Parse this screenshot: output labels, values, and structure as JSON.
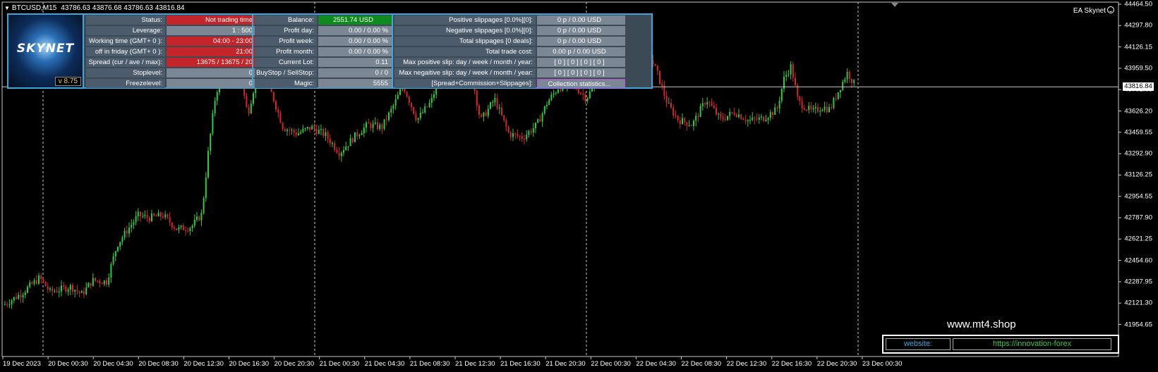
{
  "chart": {
    "symbol_tf": "BTCUSD,M15",
    "ohlc": "43786.63 43876.68 43786.63 43816.84",
    "ea_name": "EA Skynet",
    "current_price": "43816.84",
    "price_labels": [
      "44464.50",
      "44297.80",
      "44126.15",
      "43959.50",
      "43792.85",
      "43626.20",
      "43459.55",
      "43292.90",
      "43126.25",
      "42954.55",
      "42787.90",
      "42621.25",
      "42454.60",
      "42287.95",
      "42121.30",
      "41954.65"
    ],
    "time_labels": [
      "19 Dec 2023",
      "20 Dec 00:30",
      "20 Dec 04:30",
      "20 Dec 08:30",
      "20 Dec 12:30",
      "20 Dec 16:30",
      "20 Dec 20:30",
      "21 Dec 00:30",
      "21 Dec 04:30",
      "21 Dec 08:30",
      "21 Dec 12:30",
      "21 Dec 16:30",
      "21 Dec 20:30",
      "22 Dec 00:30",
      "22 Dec 04:30",
      "22 Dec 08:30",
      "22 Dec 12:30",
      "22 Dec 16:30",
      "22 Dec 20:30",
      "23 Dec 00:30"
    ],
    "colors": {
      "bull": "#2ecc40",
      "bear": "#d6262d",
      "grid": "#c8c8c8"
    }
  },
  "panel": {
    "version": "v 8.75",
    "logo_text": "SKYNET",
    "col1": [
      {
        "label": "Status:",
        "value": "Not trading time",
        "style": "red"
      },
      {
        "label": "Leverage:",
        "value": "1 : 500",
        "style": "grey"
      },
      {
        "label": "Working time (GMT+ 0 ):",
        "value": "04:00 - 23:00",
        "style": "red"
      },
      {
        "label": "off in friday (GMT+ 0 ):",
        "value": "21:00",
        "style": "red"
      },
      {
        "label": "Spread (cur / ave / max):",
        "value": "13675 / 13675 / 20",
        "style": "red"
      },
      {
        "label": "Stoplevel:",
        "value": "0",
        "style": "grey"
      },
      {
        "label": "Freezelevel:",
        "value": "0",
        "style": "grey"
      }
    ],
    "col2": [
      {
        "label": "Balance:",
        "value": "2551.74 USD",
        "style": "green"
      },
      {
        "label": "Profit day:",
        "value": "0.00 / 0.00 %",
        "style": "grey"
      },
      {
        "label": "Profit week:",
        "value": "0.00 / 0.00 %",
        "style": "grey"
      },
      {
        "label": "Profit month:",
        "value": "0.00 / 0.00 %",
        "style": "grey"
      },
      {
        "label": "Current Lot:",
        "value": "0.11",
        "style": "grey"
      },
      {
        "label": "BuyStop / SellStop:",
        "value": "0  /  0",
        "style": "grey"
      },
      {
        "label": "Magic:",
        "value": "5555",
        "style": "grey"
      }
    ],
    "col3": [
      {
        "label": "Positive slippages [0.0%][0]:",
        "value": "0 p / 0.00 USD",
        "style": "grey"
      },
      {
        "label": "Negative slippages [0.0%][0]:",
        "value": "0 p / 0.00 USD",
        "style": "grey"
      },
      {
        "label": "Total slippages [0 deals]:",
        "value": "0 p / 0.00 USD",
        "style": "grey"
      },
      {
        "label": "Total trade cost:",
        "value": "0.00 p / 0.00 USD",
        "style": "grey"
      },
      {
        "label": "Max positive slip: day / week / month / year:",
        "value": "[ 0 ] [ 0 ] [ 0 ] [ 0 ]",
        "style": "grey"
      },
      {
        "label": "Max negaitive slip: day / week / month / year:",
        "value": "[ 0 ] [ 0 ] [ 0 ] [ 0 ]",
        "style": "grey"
      },
      {
        "label": "[Spread+Commission+Slippages]:",
        "value": "Collection statistics...",
        "style": "btn"
      }
    ]
  },
  "footer": {
    "site": "www.mt4.shop",
    "website_key": "website:",
    "website_value": "https://innovation-forex"
  }
}
